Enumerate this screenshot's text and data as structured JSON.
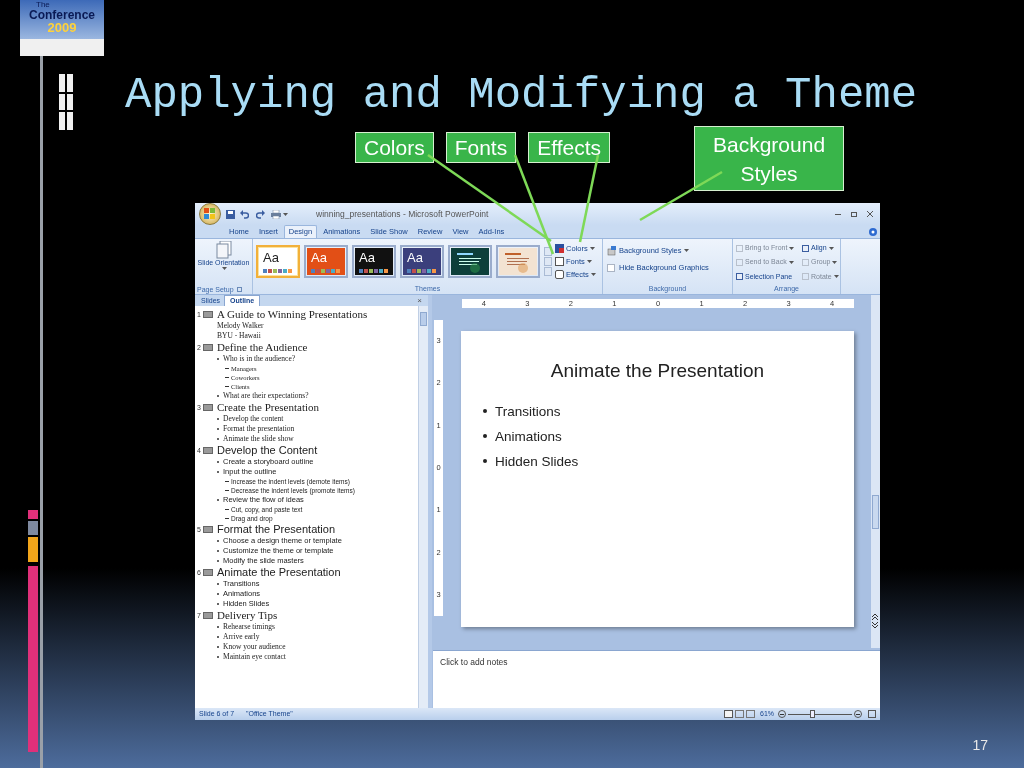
{
  "logo": {
    "lines": [
      "The",
      "Conference",
      "2009"
    ]
  },
  "title": "Applying and Modifying a Theme",
  "callouts": [
    {
      "label": "Colors"
    },
    {
      "label": "Fonts"
    },
    {
      "label": "Effects"
    },
    {
      "label": "Background Styles"
    }
  ],
  "app": {
    "window_title": "winning_presentations - Microsoft PowerPoint",
    "tabs": [
      {
        "label": "Home",
        "selected": false
      },
      {
        "label": "Insert",
        "selected": false
      },
      {
        "label": "Design",
        "selected": true
      },
      {
        "label": "Animations",
        "selected": false
      },
      {
        "label": "Slide Show",
        "selected": false
      },
      {
        "label": "Review",
        "selected": false
      },
      {
        "label": "View",
        "selected": false
      },
      {
        "label": "Add-Ins",
        "selected": false
      }
    ],
    "ribbon": {
      "page_setup": {
        "button": "Slide Orientation",
        "label": "Page Setup"
      },
      "themes": {
        "items": [
          {
            "kind": "text",
            "label": "Aa",
            "color": "#ffffff",
            "selected": true
          },
          {
            "kind": "text",
            "label": "Aa",
            "color": "#e24f16",
            "selected": false
          },
          {
            "kind": "text",
            "label": "Aa",
            "color": "#111111",
            "selected": false
          },
          {
            "kind": "text",
            "label": "Aa",
            "color": "#3b3f7c",
            "selected": false
          },
          {
            "kind": "preview",
            "color": "#0d3f3a",
            "selected": false
          },
          {
            "kind": "preview",
            "color": "#f3e3d2",
            "selected": false
          }
        ],
        "options": [
          "Colors",
          "Fonts",
          "Effects"
        ],
        "label": "Themes"
      },
      "background": {
        "styles": "Background Styles",
        "hide_graphics": {
          "label": "Hide Background Graphics",
          "checked": false
        },
        "label": "Background"
      },
      "arrange": {
        "items": [
          {
            "label": "Bring to Front",
            "disabled": true,
            "menu": true
          },
          {
            "label": "Send to Back",
            "disabled": true,
            "menu": true
          },
          {
            "label": "Selection Pane",
            "disabled": false,
            "menu": false
          },
          {
            "label": "Align",
            "disabled": false,
            "menu": true
          },
          {
            "label": "Group",
            "disabled": true,
            "menu": true
          },
          {
            "label": "Rotate",
            "disabled": true,
            "menu": true
          }
        ],
        "label": "Arrange"
      }
    },
    "pane_tabs": [
      {
        "label": "Slides",
        "selected": false
      },
      {
        "label": "Outline",
        "selected": true
      }
    ],
    "pane_close": "×",
    "outline": [
      {
        "number": "1",
        "title": "A Guide to Winning Presentations",
        "kind": "serif",
        "bulleted": false,
        "items": [
          {
            "text": "Melody Walker"
          },
          {
            "text": "BYU - Hawaii"
          }
        ]
      },
      {
        "number": "2",
        "title": "Define the Audience",
        "kind": "serif",
        "bulleted": true,
        "items": [
          {
            "text": "Who is in the audience?",
            "children": [
              {
                "text": "Managers"
              },
              {
                "text": "Coworkers"
              },
              {
                "text": "Clients"
              }
            ]
          },
          {
            "text": "What are their expectations?"
          }
        ]
      },
      {
        "number": "3",
        "title": "Create the Presentation",
        "kind": "serif",
        "bulleted": true,
        "items": [
          {
            "text": "Develop the content"
          },
          {
            "text": "Format the presentation"
          },
          {
            "text": "Animate the slide show"
          }
        ]
      },
      {
        "number": "4",
        "title": "Develop the Content",
        "kind": "sans",
        "bulleted": true,
        "items": [
          {
            "text": "Create a storyboard outline"
          },
          {
            "text": "Input the outline",
            "children": [
              {
                "text": "Increase the indent levels (demote items)"
              },
              {
                "text": "Decrease the indent levels (promote items)"
              }
            ]
          },
          {
            "text": "Review the flow of ideas",
            "children": [
              {
                "text": "Cut, copy, and paste text"
              },
              {
                "text": "Drag and drop"
              }
            ]
          }
        ]
      },
      {
        "number": "5",
        "title": "Format the Presentation",
        "kind": "sans",
        "bulleted": true,
        "items": [
          {
            "text": "Choose a design theme or template"
          },
          {
            "text": "Customize the theme or template"
          },
          {
            "text": "Modify the slide masters"
          }
        ]
      },
      {
        "number": "6",
        "title": "Animate the Presentation",
        "kind": "sans",
        "bulleted": true,
        "items": [
          {
            "text": "Transitions"
          },
          {
            "text": "Animations"
          },
          {
            "text": "Hidden Slides"
          }
        ]
      },
      {
        "number": "7",
        "title": "Delivery Tips",
        "kind": "serif",
        "bulleted": true,
        "items": [
          {
            "text": "Rehearse timings"
          },
          {
            "text": "Arrive early"
          },
          {
            "text": "Know your audience"
          },
          {
            "text": "Maintain eye contact"
          }
        ]
      }
    ],
    "ruler": {
      "horizontal": [
        "4",
        "3",
        "2",
        "1",
        "0",
        "1",
        "2",
        "3",
        "4"
      ],
      "vertical": [
        "3",
        "2",
        "1",
        "0",
        "1",
        "2",
        "3"
      ]
    },
    "slide": {
      "title": "Animate the Presentation",
      "bullets": [
        "Transitions",
        "Animations",
        "Hidden Slides"
      ]
    },
    "notes": {
      "placeholder": "Click to add notes"
    },
    "status": {
      "slide": "Slide 6 of 7",
      "theme": "\"Office Theme\"",
      "zoom": "61%",
      "zoom_slider": {
        "level": 0.38
      }
    }
  },
  "slide_number": "17"
}
